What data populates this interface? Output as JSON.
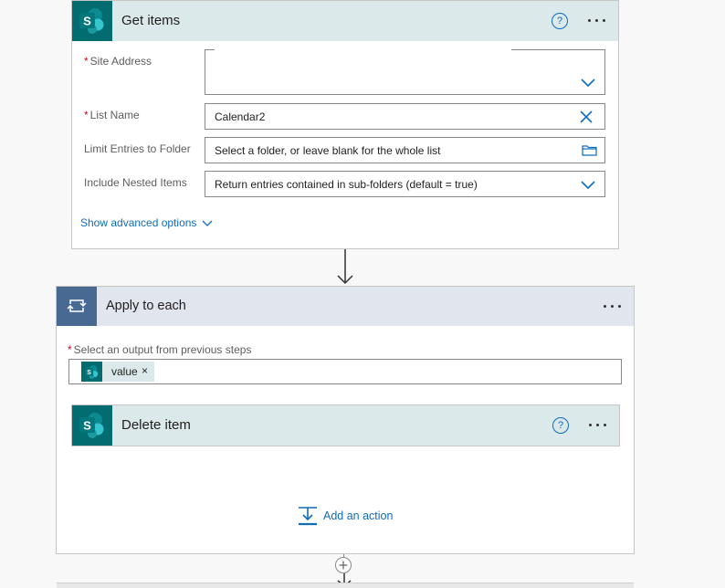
{
  "get_items": {
    "title": "Get items",
    "help": "?",
    "fields": [
      {
        "label": "Site Address",
        "required": "*",
        "value": ""
      },
      {
        "label": "List Name",
        "required": "*",
        "value": "Calendar2"
      },
      {
        "label": "Limit Entries to Folder",
        "required": "",
        "value": "Select a folder, or leave blank for the whole list"
      },
      {
        "label": "Include Nested Items",
        "required": "",
        "value": "Return entries contained in sub-folders (default = true)"
      }
    ],
    "advanced_link": "Show advanced options"
  },
  "apply_to_each": {
    "title": "Apply to each",
    "output_label": "Select an output from previous steps",
    "required": "*",
    "token": {
      "label": "value",
      "remove": "×"
    },
    "delete_item": {
      "title": "Delete item",
      "help": "?"
    },
    "add_action": "Add an action"
  },
  "colors": {
    "sharepoint_teal": "#036c70",
    "sharepoint_header": "#dbe9ea",
    "loop_blue": "#486991",
    "loop_header": "#e1e6ee",
    "link_blue": "#0f6cbd",
    "required_red": "#c50f1f"
  },
  "icons": {
    "sharepoint": "sharepoint-icon",
    "loop": "loop-icon",
    "help": "help-icon",
    "more": "more-options-icon",
    "chevron": "chevron-down-icon",
    "clear": "close-icon",
    "folder": "folder-icon",
    "add": "add-action-icon",
    "plus": "plus-icon",
    "arrow": "arrow-down-icon"
  }
}
